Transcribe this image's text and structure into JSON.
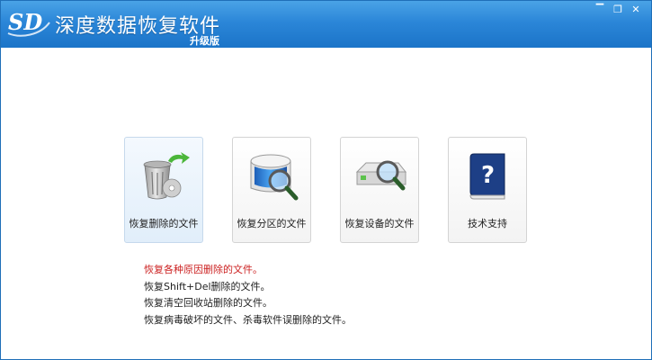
{
  "window": {
    "title": "深度数据恢复软件",
    "subtitle": "升级版",
    "logo_text": "SD",
    "controls": {
      "minimize": "▔",
      "restore": "❐",
      "close": "✕"
    }
  },
  "cards": [
    {
      "label": "恢复删除的文件",
      "icon": "trash-restore-icon",
      "selected": true
    },
    {
      "label": "恢复分区的文件",
      "icon": "partition-search-icon",
      "selected": false
    },
    {
      "label": "恢复设备的文件",
      "icon": "device-search-icon",
      "selected": false
    },
    {
      "label": "技术支持",
      "icon": "help-book-icon",
      "selected": false
    }
  ],
  "description": {
    "lines": [
      "恢复各种原因删除的文件。",
      "恢复Shift+Del删除的文件。",
      "恢复清空回收站删除的文件。",
      "恢复病毒破坏的文件、杀毒软件误删除的文件。"
    ],
    "highlight_color": "#cc2222"
  },
  "colors": {
    "title_bar": "#2b86d8",
    "accent": "#1b74c8"
  }
}
